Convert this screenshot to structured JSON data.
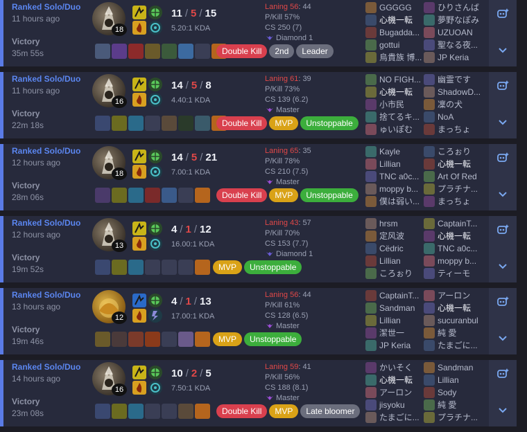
{
  "colors": {
    "accent": "#5a7be6",
    "kill_death": "#e04848",
    "mvp": "#d9a217",
    "unstoppable": "#3cae3c",
    "double_kill": "#d9404e",
    "neutral_badge": "#6b6e7d"
  },
  "matches": [
    {
      "queue": "Ranked Solo/Duo",
      "ago": "11 hours ago",
      "result": "Victory",
      "duration": "35m 55s",
      "champion_level": "18",
      "kills": "11",
      "deaths": "5",
      "assists": "15",
      "kda_ratio": "5.20:1 KDA",
      "laning_label": "Laning 56",
      "laning_score": ": 44",
      "pkill": "P/Kill 57%",
      "cs": "CS 250 (7)",
      "tier": "Diamond 1",
      "tier_color": "#6a5cd6",
      "badges": [
        {
          "label": "Double Kill",
          "color": "#d9404e"
        },
        {
          "label": "2nd",
          "color": "#6b6e7d"
        },
        {
          "label": "Leader",
          "color": "#6b6e7d"
        }
      ],
      "team1": [
        "GGGGG",
        "心機一転",
        "Bugadda...",
        "gottui",
        "烏貴族 博..."
      ],
      "team2": [
        "ひりさんば",
        "夢野なぽみ",
        "UZUOAN",
        "聖なる夜...",
        "JP Keria"
      ]
    },
    {
      "queue": "Ranked Solo/Duo",
      "ago": "11 hours ago",
      "result": "Victory",
      "duration": "22m 18s",
      "champion_level": "16",
      "kills": "14",
      "deaths": "5",
      "assists": "8",
      "kda_ratio": "4.40:1 KDA",
      "laning_label": "Laning 61",
      "laning_score": ": 39",
      "pkill": "P/Kill 73%",
      "cs": "CS 139 (6.2)",
      "tier": "Master",
      "tier_color": "#9c4fd6",
      "badges": [
        {
          "label": "Double Kill",
          "color": "#d9404e"
        },
        {
          "label": "MVP",
          "color": "#d9a217"
        },
        {
          "label": "Unstoppable",
          "color": "#3cae3c"
        }
      ],
      "team1": [
        "NO FIGH...",
        "心機一転",
        "小市民",
        "捨てるキ...",
        "ゅいぽむ"
      ],
      "team2": [
        "幽霊です",
        "ShadowD...",
        "凜の犬",
        "NoA",
        "まっちょ"
      ]
    },
    {
      "queue": "Ranked Solo/Duo",
      "ago": "12 hours ago",
      "result": "Victory",
      "duration": "28m 06s",
      "champion_level": "18",
      "kills": "14",
      "deaths": "5",
      "assists": "21",
      "kda_ratio": "7.00:1 KDA",
      "laning_label": "Laning 65",
      "laning_score": ": 35",
      "pkill": "P/Kill 78%",
      "cs": "CS 210 (7.5)",
      "tier": "Master",
      "tier_color": "#9c4fd6",
      "badges": [
        {
          "label": "Double Kill",
          "color": "#d9404e"
        },
        {
          "label": "MVP",
          "color": "#d9a217"
        },
        {
          "label": "Unstoppable",
          "color": "#3cae3c"
        }
      ],
      "team1": [
        "Kayle",
        "Lillian",
        "TNC a0c...",
        "moppy b...",
        "僕は弱い..."
      ],
      "team2": [
        "ころぉり",
        "心機一転",
        "Art Of Red",
        "プラチナ...",
        "まっちょ"
      ]
    },
    {
      "queue": "Ranked Solo/Duo",
      "ago": "12 hours ago",
      "result": "Victory",
      "duration": "19m 52s",
      "champion_level": "13",
      "kills": "4",
      "deaths": "1",
      "assists": "12",
      "kda_ratio": "16.00:1 KDA",
      "laning_label": "Laning 43",
      "laning_score": ": 57",
      "pkill": "P/Kill 70%",
      "cs": "CS 153 (7.7)",
      "tier": "Diamond 1",
      "tier_color": "#6a5cd6",
      "badges": [
        {
          "label": "MVP",
          "color": "#d9a217"
        },
        {
          "label": "Unstoppable",
          "color": "#3cae3c"
        }
      ],
      "team1": [
        "hrsm",
        "定风波",
        "Cëdric",
        "Lillian",
        "ころぉり"
      ],
      "team2": [
        "CaptainT...",
        "心機一転",
        "TNC a0c...",
        "moppy b...",
        "ティーモ"
      ]
    },
    {
      "queue": "Ranked Solo/Duo",
      "ago": "13 hours ago",
      "result": "Victory",
      "duration": "19m 46s",
      "champion_level": "12",
      "kills": "4",
      "deaths": "1",
      "assists": "13",
      "kda_ratio": "17.00:1 KDA",
      "laning_label": "Laning 56",
      "laning_score": ": 44",
      "pkill": "P/Kill 61%",
      "cs": "CS 128 (6.5)",
      "tier": "Master",
      "tier_color": "#9c4fd6",
      "badges": [
        {
          "label": "MVP",
          "color": "#d9a217"
        },
        {
          "label": "Unstoppable",
          "color": "#3cae3c"
        }
      ],
      "team1": [
        "CaptainT...",
        "Sandman",
        "Lillian",
        "潔世一",
        "JP Keria"
      ],
      "team2": [
        "アーロン",
        "心機一転",
        "sucuranbul",
        "純 愛",
        "たまごに..."
      ]
    },
    {
      "queue": "Ranked Solo/Duo",
      "ago": "14 hours ago",
      "result": "Victory",
      "duration": "23m 08s",
      "champion_level": "16",
      "kills": "10",
      "deaths": "2",
      "assists": "5",
      "kda_ratio": "7.50:1 KDA",
      "laning_label": "Laning 59",
      "laning_score": ": 41",
      "pkill": "P/Kill 56%",
      "cs": "CS 188 (8.1)",
      "tier": "Master",
      "tier_color": "#9c4fd6",
      "badges": [
        {
          "label": "Double Kill",
          "color": "#d9404e"
        },
        {
          "label": "MVP",
          "color": "#d9a217"
        },
        {
          "label": "Late bloomer",
          "color": "#6b6e7d"
        }
      ],
      "team1": [
        "かいそく",
        "心機一転",
        "アーロン",
        "jisyoku",
        "たまごに..."
      ],
      "team2": [
        "Sandman",
        "Lillian",
        "Sody",
        "純 愛",
        "プラチナ..."
      ]
    }
  ]
}
